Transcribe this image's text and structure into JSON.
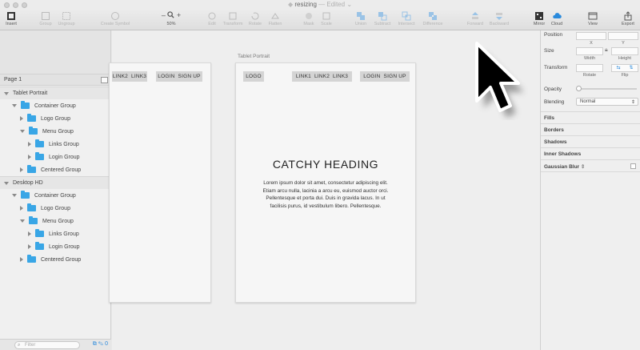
{
  "window": {
    "title": "resizing",
    "status": "— Edited",
    "chevron": "⌄"
  },
  "toolbar": {
    "insert": "Insert",
    "group": "Group",
    "ungroup": "Ungroup",
    "create_symbol": "Create Symbol",
    "zoom_minus": "–",
    "zoom_plus": "+",
    "zoom": "50%",
    "edit": "Edit",
    "transform": "Transform",
    "rotate": "Rotate",
    "flatten": "Flatten",
    "mask": "Mask",
    "scale": "Scale",
    "union": "Union",
    "subtract": "Subtract",
    "intersect": "Intersect",
    "difference": "Difference",
    "forward": "Forward",
    "backward": "Backward",
    "mirror": "Mirror",
    "cloud": "Cloud",
    "view": "View",
    "export": "Export"
  },
  "left_panel": {
    "page": "Page 1",
    "filter_placeholder": "Filter",
    "count": "0",
    "layers": [
      {
        "label": "Tablet Portrait",
        "type": "artboard"
      },
      {
        "label": "Container Group",
        "type": "group-open",
        "level": 1
      },
      {
        "label": "Logo Group",
        "type": "group-closed",
        "level": 2
      },
      {
        "label": "Menu Group",
        "type": "group-open",
        "level": 2
      },
      {
        "label": "Links Group",
        "type": "group-closed",
        "level": 3
      },
      {
        "label": "Login Group",
        "type": "group-closed",
        "level": 3
      },
      {
        "label": "Centered Group",
        "type": "group-closed",
        "level": 2
      },
      {
        "label": "Desktop HD",
        "type": "artboard"
      },
      {
        "label": "Container Group",
        "type": "group-open",
        "level": 1
      },
      {
        "label": "Logo Group",
        "type": "group-closed",
        "level": 2
      },
      {
        "label": "Menu Group",
        "type": "group-open",
        "level": 2
      },
      {
        "label": "Links Group",
        "type": "group-closed",
        "level": 3
      },
      {
        "label": "Login Group",
        "type": "group-closed",
        "level": 3
      },
      {
        "label": "Centered Group",
        "type": "group-closed",
        "level": 2
      }
    ]
  },
  "canvas": {
    "left_board": {
      "link2": "LINK2",
      "link3": "LINK3",
      "login": "LOGIN",
      "signup": "SIGN UP"
    },
    "tablet": {
      "label": "Tablet Portrait",
      "logo": "LOGO",
      "link1": "LINK1",
      "link2": "LINK2",
      "link3": "LINK3",
      "login": "LOGIN",
      "signup": "SIGN UP",
      "heading": "CATCHY HEADING",
      "body_lines": [
        "Lorem ipsum dolor sit amet, consectetur adipiscing elit.",
        "Etiam arcu nulla, lacinia a arcu eu, euismod auctor orci.",
        "Pellentesque et porta dui. Duis in gravida lacus. In ut",
        "facilisis purus, id vestibulum libero. Pellentesque."
      ]
    }
  },
  "inspector": {
    "position": "Position",
    "x": "X",
    "y": "Y",
    "size": "Size",
    "width": "Width",
    "height": "Height",
    "transform": "Transform",
    "rotate": "Rotate",
    "flip": "Flip",
    "opacity": "Opacity",
    "blending": "Blending",
    "blending_value": "Normal",
    "fills": "Fills",
    "borders": "Borders",
    "shadows": "Shadows",
    "inner_shadows": "Inner Shadows",
    "gaussian_blur": "Gaussian Blur"
  }
}
